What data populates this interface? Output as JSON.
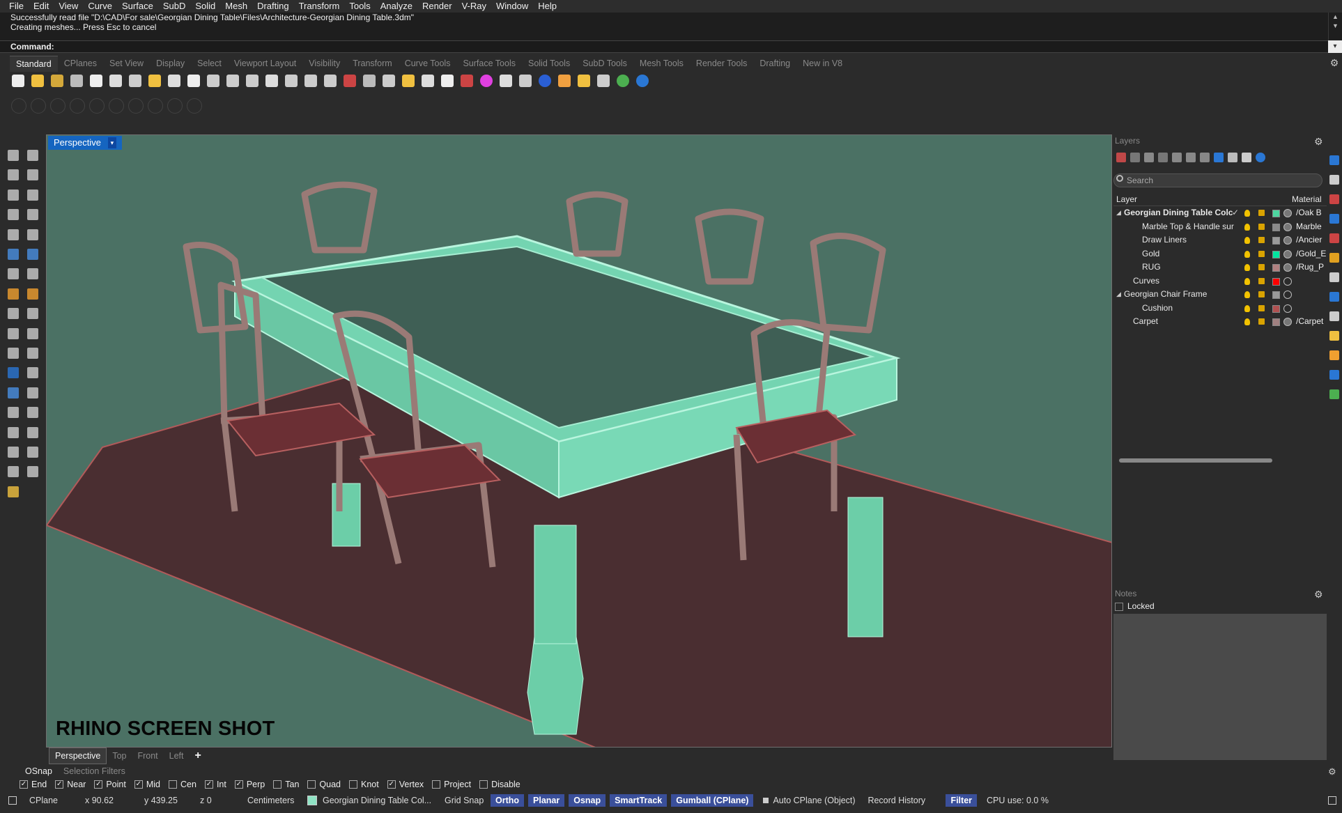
{
  "menu": [
    "File",
    "Edit",
    "View",
    "Curve",
    "Surface",
    "SubD",
    "Solid",
    "Mesh",
    "Drafting",
    "Transform",
    "Tools",
    "Analyze",
    "Render",
    "V-Ray",
    "Window",
    "Help"
  ],
  "command_history": [
    "Successfully read file \"D:\\CAD\\For sale\\Georgian Dining Table\\Files\\Architecture-Georgian Dining Table.3dm\"",
    "Creating meshes... Press Esc to cancel"
  ],
  "command_prompt": "Command:",
  "toolbar_tabs": [
    "Standard",
    "CPlanes",
    "Set View",
    "Display",
    "Select",
    "Viewport Layout",
    "Visibility",
    "Transform",
    "Curve Tools",
    "Surface Tools",
    "Solid Tools",
    "SubD Tools",
    "Mesh Tools",
    "Render Tools",
    "Drafting",
    "New in V8"
  ],
  "toolbar_active_tab": "Standard",
  "viewport": {
    "title": "Perspective",
    "watermark": "RHINO SCREEN SHOT",
    "tabs": [
      "Perspective",
      "Top",
      "Front",
      "Left"
    ],
    "add_tab": "+"
  },
  "layers": {
    "title": "Layers",
    "search_placeholder": "Search",
    "col_layer": "Layer",
    "col_material": "Material",
    "rows": [
      {
        "name": "Georgian Dining Table Colc",
        "indent": 0,
        "expanded": true,
        "bold": true,
        "color": "#4dd6a0",
        "material": "/Oak B",
        "check": true
      },
      {
        "name": "Marble Top & Handle sur",
        "indent": 2,
        "color": "#8a8a8a",
        "material": "Marble"
      },
      {
        "name": "Draw Liners",
        "indent": 2,
        "color": "#9a9a9a",
        "material": "/Ancier"
      },
      {
        "name": "Gold",
        "indent": 2,
        "color": "#00e5a0",
        "material": "/Gold_E"
      },
      {
        "name": "RUG",
        "indent": 2,
        "color": "#b08080",
        "material": "/Rug_P"
      },
      {
        "name": "Curves",
        "indent": 1,
        "color": "#ff0000",
        "material": ""
      },
      {
        "name": "Georgian Chair Frame",
        "indent": 0,
        "expanded": true,
        "color": "#9a9a9a",
        "material": ""
      },
      {
        "name": "Cushion",
        "indent": 2,
        "color": "#b05050",
        "material": ""
      },
      {
        "name": "Carpet",
        "indent": 1,
        "color": "#a08080",
        "material": "/Carpet"
      }
    ]
  },
  "notes": {
    "title": "Notes",
    "locked_label": "Locked"
  },
  "osnap_tabs": [
    "OSnap",
    "Selection Filters"
  ],
  "osnaps": [
    {
      "label": "End",
      "checked": true
    },
    {
      "label": "Near",
      "checked": true
    },
    {
      "label": "Point",
      "checked": true
    },
    {
      "label": "Mid",
      "checked": true
    },
    {
      "label": "Cen",
      "checked": false
    },
    {
      "label": "Int",
      "checked": true
    },
    {
      "label": "Perp",
      "checked": true
    },
    {
      "label": "Tan",
      "checked": false
    },
    {
      "label": "Quad",
      "checked": false
    },
    {
      "label": "Knot",
      "checked": false
    },
    {
      "label": "Vertex",
      "checked": true
    },
    {
      "label": "Project",
      "checked": false
    },
    {
      "label": "Disable",
      "checked": false
    }
  ],
  "status": {
    "cplane": "CPlane",
    "x": "x 90.62",
    "y": "y 439.25",
    "z": "z 0",
    "units": "Centimeters",
    "layer": "Georgian Dining Table Col...",
    "grid_snap": "Grid Snap",
    "ortho": "Ortho",
    "planar": "Planar",
    "osnap": "Osnap",
    "smarttrack": "SmartTrack",
    "gumball": "Gumball (CPlane)",
    "auto_cplane": "Auto CPlane (Object)",
    "record_history": "Record History",
    "filter": "Filter",
    "cpu": "CPU use: 0.0 %"
  },
  "colors": {
    "viewport_bg": "#4b7164",
    "rug": "#4a2e31",
    "table": "#88e6c2",
    "chair": "#9a7a76",
    "highlight": "#1565c0"
  }
}
